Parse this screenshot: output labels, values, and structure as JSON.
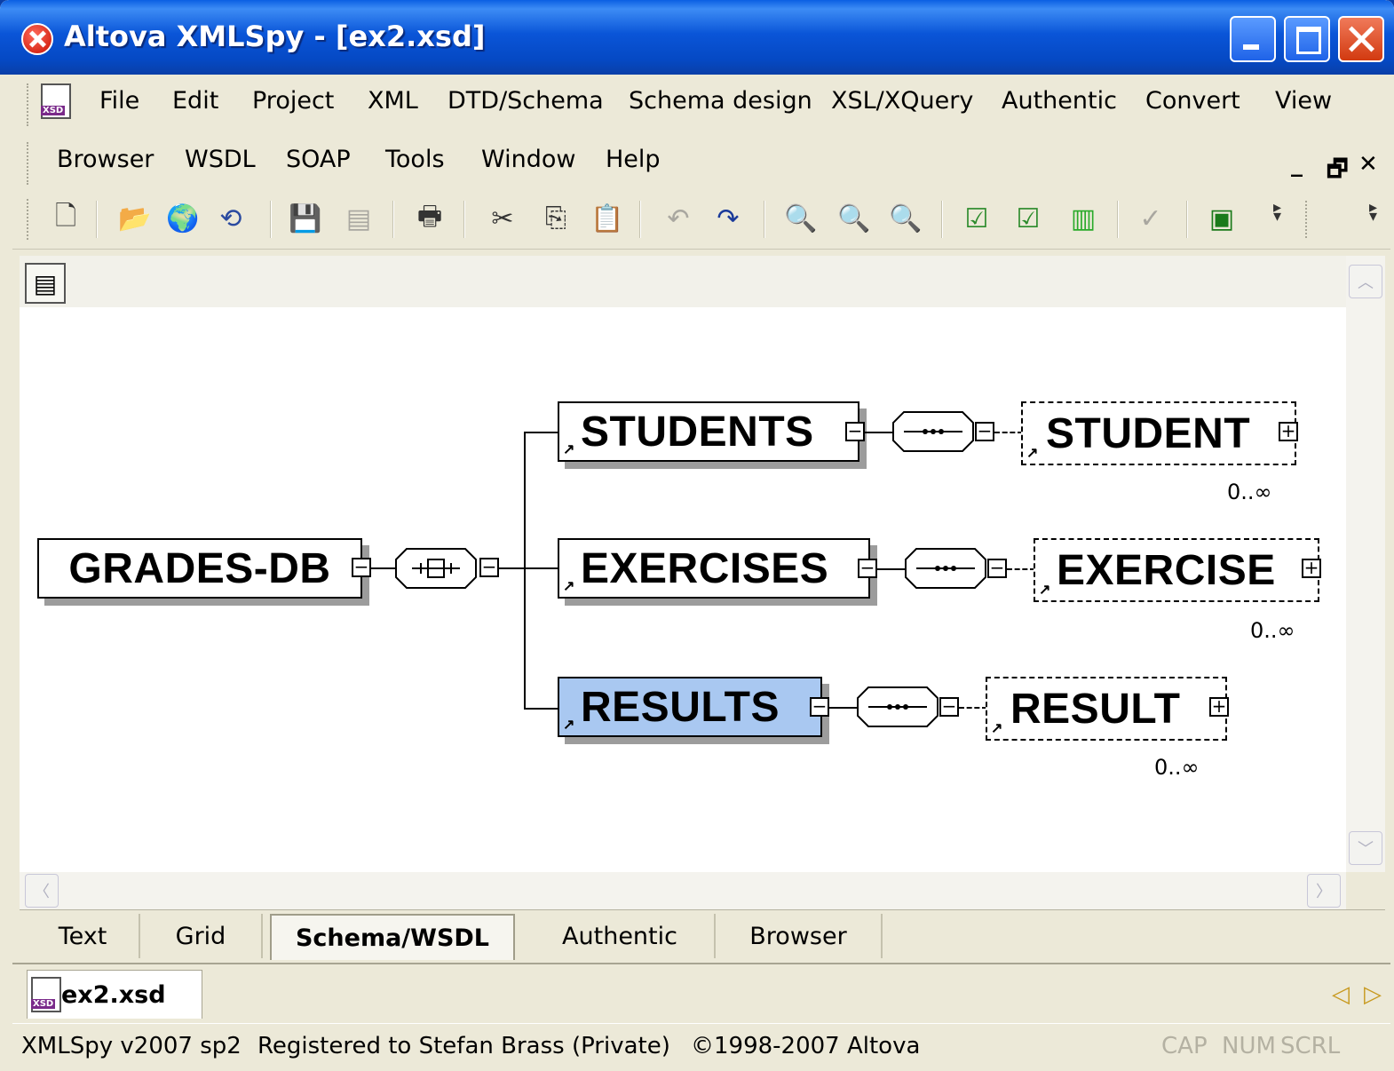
{
  "window": {
    "title": "Altova XMLSpy - [ex2.xsd]"
  },
  "menu": {
    "row1": [
      "File",
      "Edit",
      "Project",
      "XML",
      "DTD/Schema",
      "Schema design",
      "XSL/XQuery",
      "Authentic",
      "Convert",
      "View"
    ],
    "row2": [
      "Browser",
      "WSDL",
      "SOAP",
      "Tools",
      "Window",
      "Help"
    ]
  },
  "toolbar": {
    "icons": [
      "new-icon",
      "open-icon",
      "open-url-icon",
      "reload-icon",
      "save-icon",
      "save-all-icon",
      "print-icon",
      "cut-icon",
      "copy-icon",
      "paste-icon",
      "undo-icon",
      "redo-icon",
      "find-icon",
      "find-next-icon",
      "replace-icon",
      "check-wellformed-icon",
      "validate-icon",
      "generate-dtd-icon",
      "spellcheck-icon",
      "xsl-transform-icon"
    ]
  },
  "diagram": {
    "root": "GRADES-DB",
    "children": [
      {
        "name": "STUDENTS",
        "child": "STUDENT",
        "occurrence": "0..∞"
      },
      {
        "name": "EXERCISES",
        "child": "EXERCISE",
        "occurrence": "0..∞"
      },
      {
        "name": "RESULTS",
        "child": "RESULT",
        "occurrence": "0..∞",
        "selected": true
      }
    ]
  },
  "view_tabs": [
    "Text",
    "Grid",
    "Schema/WSDL",
    "Authentic",
    "Browser"
  ],
  "active_view_tab": "Schema/WSDL",
  "document_tab": "ex2.xsd",
  "status": {
    "version": "XMLSpy v2007 sp2",
    "registered": "Registered to Stefan Brass (Private)",
    "copyright": "©1998-2007 Altova",
    "indicators": [
      "CAP",
      "NUM",
      "SCRL"
    ]
  },
  "colors": {
    "selected": "#a9c8f1",
    "titlebar": "#0a55d8"
  }
}
